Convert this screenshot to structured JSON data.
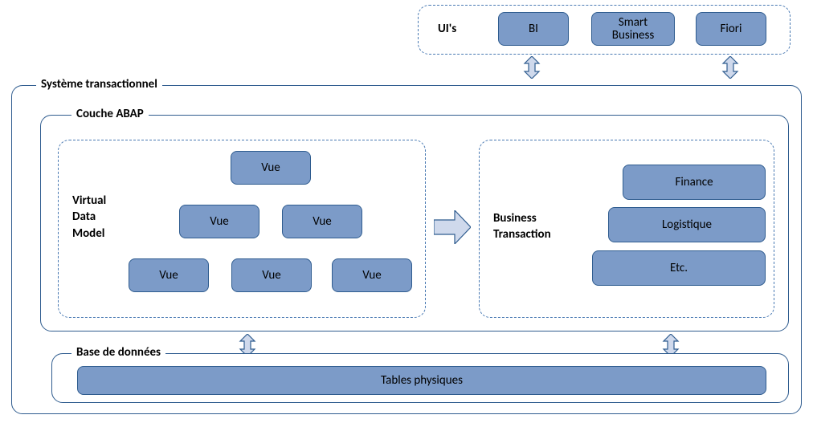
{
  "ui_box": {
    "title": "UI's",
    "items": [
      "BI",
      "Smart\nBusiness",
      "Fiori"
    ]
  },
  "transactional": {
    "title": "Système transactionnel",
    "abap": {
      "title": "Couche ABAP",
      "vdm": {
        "title": "Virtual\nData\nModel",
        "nodes": [
          "Vue",
          "Vue",
          "Vue",
          "Vue",
          "Vue",
          "Vue"
        ]
      },
      "bt": {
        "title": "Business\nTransaction",
        "stack": [
          "Finance",
          "Logistique",
          "Etc."
        ]
      }
    },
    "db": {
      "title": "Base de données",
      "table": "Tables physiques"
    }
  }
}
